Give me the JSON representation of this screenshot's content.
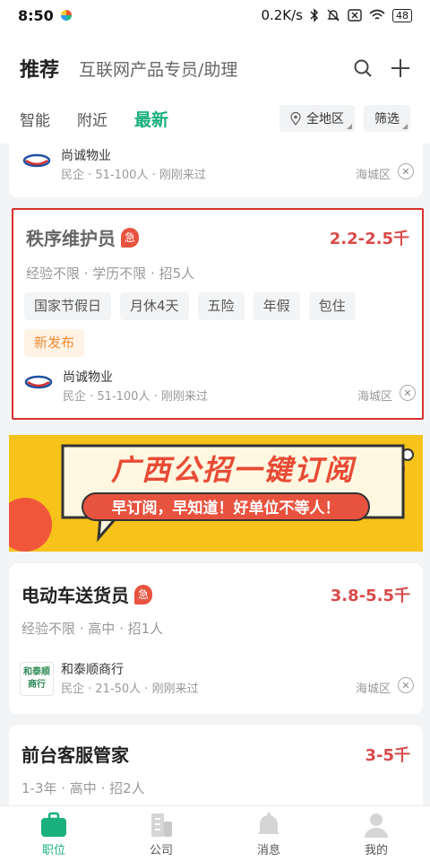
{
  "status_bar": {
    "time": "8:50",
    "net_speed": "0.2K/s",
    "battery": "48"
  },
  "header": {
    "title": "推荐",
    "subtitle": "互联网产品专员/助理",
    "filter_tabs": [
      "智能",
      "附近",
      "最新"
    ],
    "active_tab": "最新",
    "area_filter": "全地区",
    "filter_button": "筛选"
  },
  "jobs": [
    {
      "title": "",
      "company": {
        "name": "尚诚物业",
        "info": "民企 · 51-100人 · 刚刚来过",
        "district": "海城区",
        "logo_text": "尚诚物业"
      }
    },
    {
      "title": "秩序维护员",
      "urgent": "急",
      "salary": "2.2-2.5千",
      "requirements": "经验不限 · 学历不限 · 招5人",
      "tags": [
        "国家节假日",
        "月休4天",
        "五险",
        "年假",
        "包住"
      ],
      "new_tag": "新发布",
      "company": {
        "name": "尚诚物业",
        "info": "民企 · 51-100人 · 刚刚来过",
        "district": "海城区",
        "logo_text": "尚诚物业"
      }
    },
    {
      "title": "电动车送货员",
      "urgent": "急",
      "salary": "3.8-5.5千",
      "requirements": "经验不限 · 高中 · 招1人",
      "company": {
        "name": "和泰顺商行",
        "info": "民企 · 21-50人 · 刚刚来过",
        "district": "海城区",
        "logo_line1": "和泰顺",
        "logo_line2": "商行"
      }
    },
    {
      "title": "前台客服管家",
      "salary": "3-5千",
      "requirements": "1-3年 · 高中 · 招2人"
    }
  ],
  "banner": {
    "headline": "广西公招一键订阅",
    "slogan": "早订阅，早知道！好单位不等人！"
  },
  "tabbar": [
    {
      "label": "职位",
      "icon": "briefcase-icon"
    },
    {
      "label": "公司",
      "icon": "building-icon"
    },
    {
      "label": "消息",
      "icon": "bell-icon"
    },
    {
      "label": "我的",
      "icon": "user-icon"
    }
  ],
  "colors": {
    "accent": "#19b07e",
    "salary": "#d84a4a",
    "highlight_border": "#d9312e",
    "banner_bg": "#f7c31b"
  }
}
